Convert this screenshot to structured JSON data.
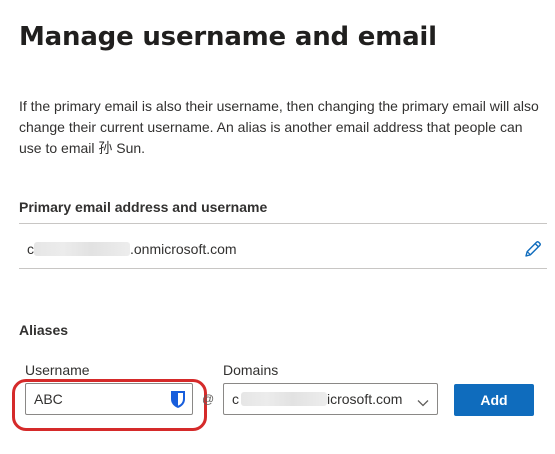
{
  "page": {
    "title": "Manage username and email",
    "description": "If the primary email is also their username, then changing the primary email will also change their current username. An alias is another email address that people can use to email 孙 Sun."
  },
  "primary": {
    "label": "Primary email address and username",
    "prefix": "c",
    "value_visible": ".onmicrosoft.com",
    "edit_icon": "pencil-icon"
  },
  "aliases": {
    "label": "Aliases",
    "username_label": "Username",
    "username_value": "ABC",
    "at_symbol": "@",
    "domains_label": "Domains",
    "domain_prefix": "c",
    "domain_value_visible": "icrosoft.com",
    "add_label": "Add",
    "accent_color": "#0f6cbd",
    "highlight_color": "#d52a2a"
  }
}
